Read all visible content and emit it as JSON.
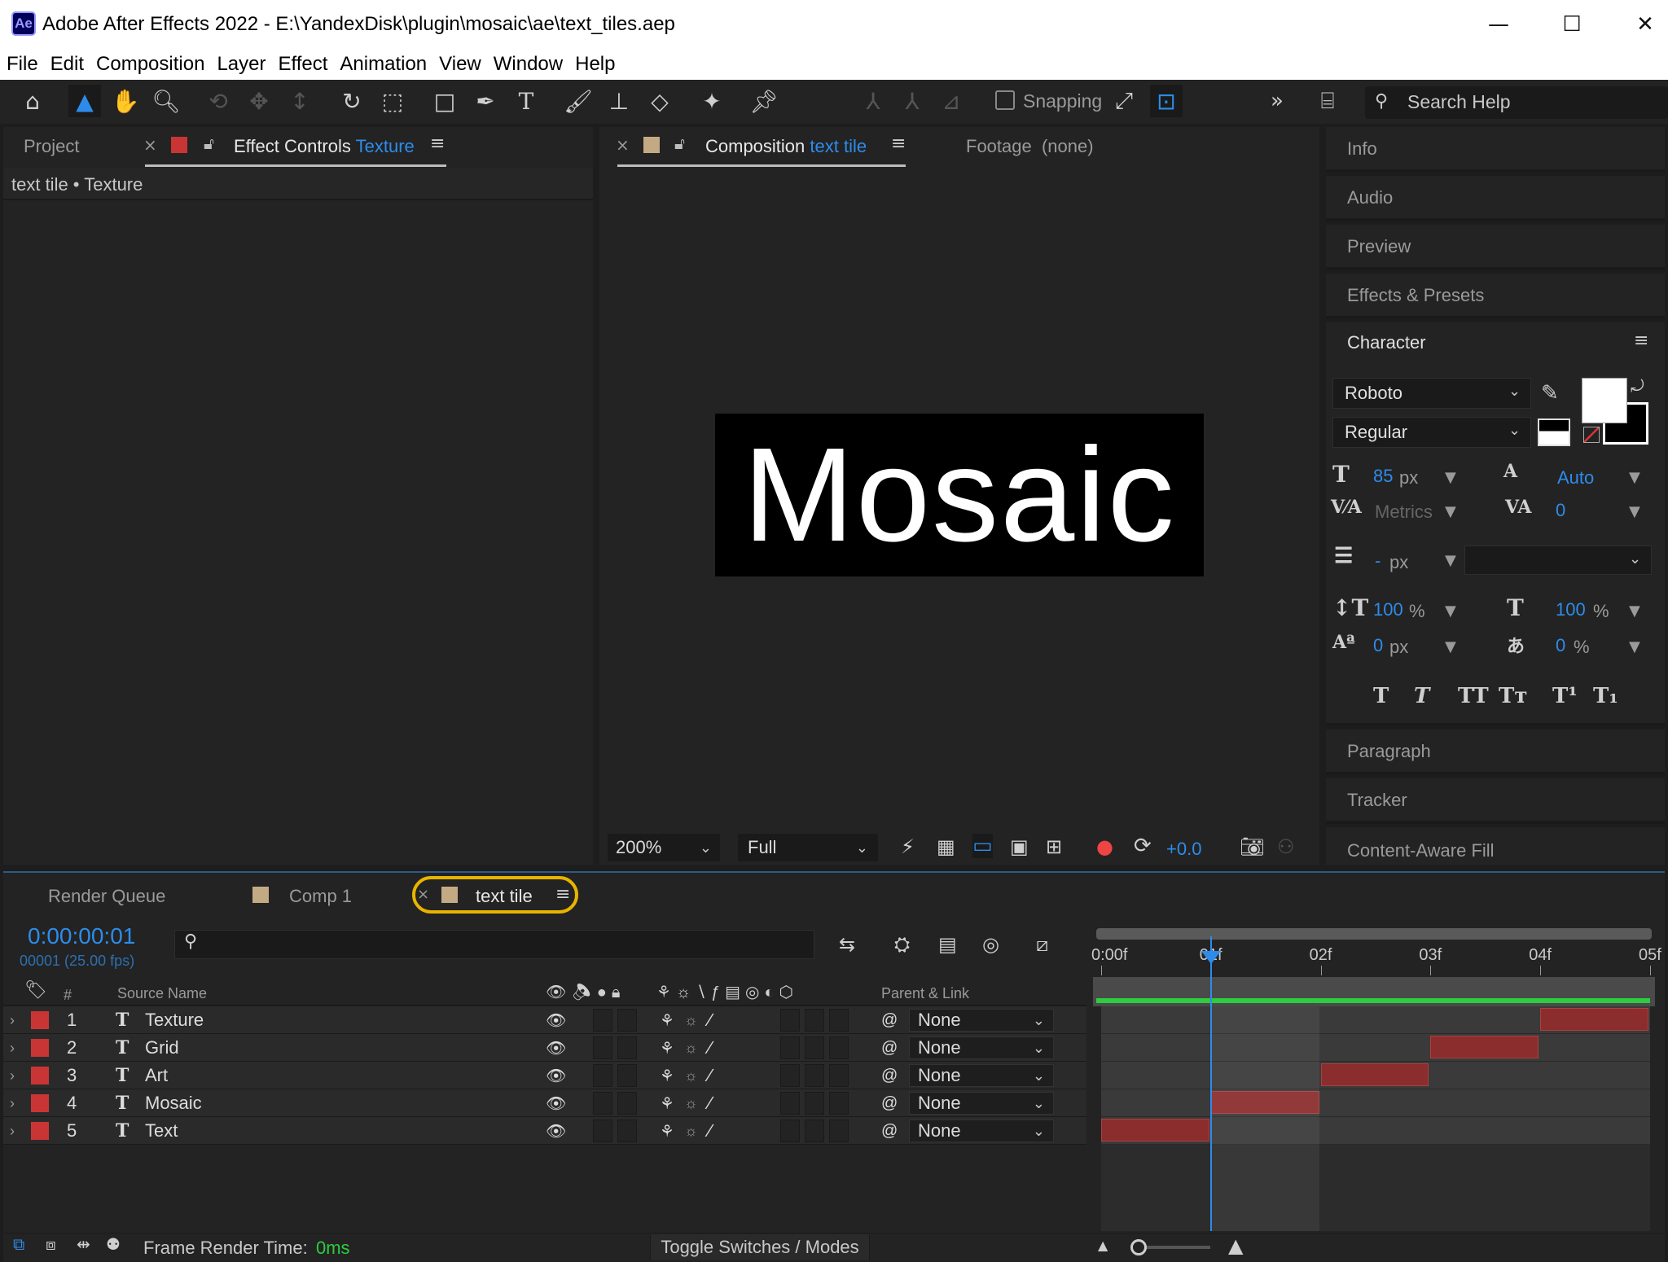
{
  "app": {
    "icon_text": "Ae",
    "window_title": "Adobe After Effects 2022 - E:\\YandexDisk\\plugin\\mosaic\\ae\\text_tiles.aep",
    "window_controls": {
      "minimize": "—",
      "maximize": "☐",
      "close": "✕"
    }
  },
  "menu": [
    "File",
    "Edit",
    "Composition",
    "Layer",
    "Effect",
    "Animation",
    "View",
    "Window",
    "Help"
  ],
  "toolbar": {
    "snapping_label": "Snapping",
    "search_placeholder": "Search Help",
    "icons": [
      "home-icon",
      "selection-tool-icon",
      "hand-tool-icon",
      "zoom-tool-icon",
      "orbit-camera-icon",
      "pan-camera-icon",
      "dolly-camera-icon",
      "rotation-tool-icon",
      "pan-behind-icon",
      "rectangle-tool-icon",
      "pen-tool-icon",
      "type-tool-icon",
      "brush-tool-icon",
      "clone-stamp-icon",
      "eraser-tool-icon",
      "roto-brush-icon",
      "puppet-pin-icon"
    ]
  },
  "left_panel": {
    "tab_project": "Project",
    "tab_effect_controls_prefix": "Effect Controls",
    "tab_effect_controls_layer": "Texture",
    "breadcrumb": "text tile • Texture"
  },
  "viewer": {
    "tab_composition_prefix": "Composition",
    "tab_composition_name": "text tile",
    "tab_footage": "Footage  (none)",
    "canvas_text": "Mosaic",
    "zoom": "200%",
    "resolution": "Full",
    "exposure": "+0.0"
  },
  "right_panel": {
    "sections_top": [
      "Info",
      "Audio",
      "Preview",
      "Effects & Presets"
    ],
    "character": {
      "title": "Character",
      "font_family": "Roboto",
      "font_style": "Regular",
      "font_size": "85",
      "font_size_unit": "px",
      "leading": "Auto",
      "kerning": "Metrics",
      "tracking": "0",
      "stroke_width": "-",
      "stroke_unit": "px",
      "vertical_scale": "100",
      "horizontal_scale": "100",
      "percent": "%",
      "baseline_shift": "0",
      "baseline_unit": "px",
      "tsume": "0",
      "style_buttons": [
        "T",
        "T",
        "TT",
        "Tт",
        "T¹",
        "T₁"
      ],
      "fill_color": "#ffffff",
      "stroke_color": "#000000"
    },
    "sections_bottom": [
      "Paragraph",
      "Tracker",
      "Content-Aware Fill"
    ]
  },
  "timeline": {
    "tabs": [
      "Render Queue",
      "Comp 1",
      "text tile"
    ],
    "timecode": "0:00:00:01",
    "frame_info": "00001 (25.00 fps)",
    "col_source_name": "Source Name",
    "col_number": "#",
    "col_parent": "Parent & Link",
    "ruler_ticks": [
      "0:00f",
      "01f",
      "02f",
      "03f",
      "04f",
      "05f"
    ],
    "current_frame": 1,
    "total_frames": 5,
    "layers": [
      {
        "num": "1",
        "name": "Texture",
        "parent": "None",
        "in": 4,
        "out": 5
      },
      {
        "num": "2",
        "name": "Grid",
        "parent": "None",
        "in": 3,
        "out": 4
      },
      {
        "num": "3",
        "name": "Art",
        "parent": "None",
        "in": 2,
        "out": 3
      },
      {
        "num": "4",
        "name": "Mosaic",
        "parent": "None",
        "in": 1,
        "out": 2
      },
      {
        "num": "5",
        "name": "Text",
        "parent": "None",
        "in": 0,
        "out": 1
      }
    ],
    "footer_label": "Frame Render Time:",
    "footer_value": "0ms",
    "toggle_label": "Toggle Switches / Modes"
  },
  "colors": {
    "accent": "#2d8ceb",
    "label_red": "#c93535",
    "highlight": "#e8b400",
    "work_area": "#2ecc40"
  }
}
